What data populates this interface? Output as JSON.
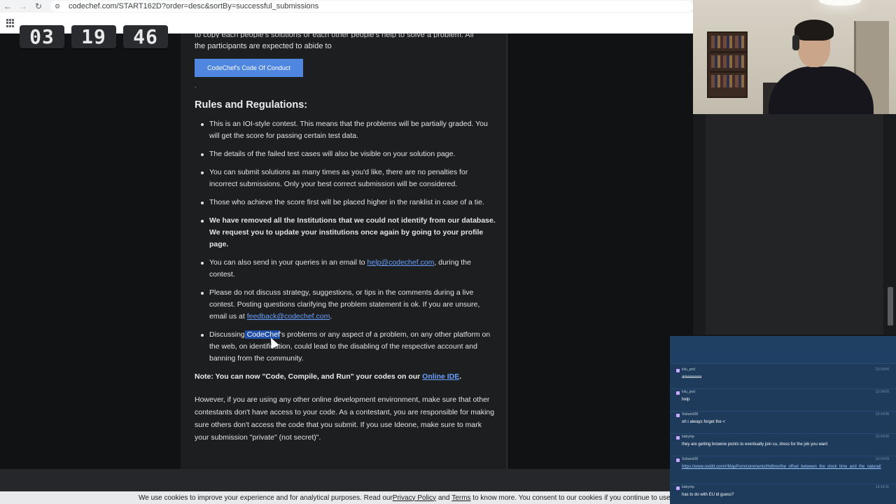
{
  "browser": {
    "url": "codechef.com/START162D?order=desc&sortBy=successful_submissions"
  },
  "timer": {
    "hours": "03",
    "minutes": "19",
    "seconds": "46"
  },
  "article": {
    "cut_text": "to copy each people's solutions or each other people's help to solve a problem. All",
    "intro_text": "the participants are expected to abide to",
    "coc_button": "CodeChef's Code Of Conduct",
    "dot": ".",
    "rules_title": "Rules and Regulations:",
    "rules": [
      {
        "text": "This is an IOI-style contest. This means that the problems will be partially graded. You will get the score for passing certain test data."
      },
      {
        "text": "The details of the failed test cases will also be visible on your solution page."
      },
      {
        "text": "You can submit solutions as many times as you'd like, there are no penalties for incorrect submissions. Only your best correct submission will be considered."
      },
      {
        "text": "Those who achieve the score first will be placed higher in the ranklist in case of a tie."
      },
      {
        "text": "We have removed all the Institutions that we could not identify from our database. We request you to update your institutions once again by going to your profile page."
      },
      {
        "before": "You can also send in your queries in an email to ",
        "link": "help@codechef.com",
        "after": ", during the contest."
      },
      {
        "before": "Please do not discuss strategy, suggestions, or tips in the comments during a live contest. Posting questions clarifying the problem statement is ok. If you are unsure, email us at ",
        "link": "feedback@codechef.com",
        "after": "."
      },
      {
        "before": "Discussing",
        "highlight": " CodeChef",
        "after": "'s problems or any aspect of a problem, on any other platform on the web, on identification, could lead to the disabling of the respective account and banning from the community."
      }
    ],
    "note_before": "Note: You can now \"Code, Compile, and Run\" your codes on our ",
    "note_link": "Online IDE",
    "note_after": ".",
    "paragraph": "However, if you are using any other online development environment, make sure that other contestants don't have access to your code. As a contestant, you are responsible for making sure others don't access the code that you submit. If you use Ideone, make sure to mark your submission \"private\" (not secret)\"."
  },
  "cookie_bar": {
    "before": "We use cookies to improve your experience and for analytical purposes. Read our ",
    "privacy": "Privacy Policy",
    "and": " and ",
    "terms": "Terms",
    "after": " to know more. You consent to our cookies if you continue to use our webs"
  },
  "chat": {
    "messages": [
      {
        "user": "lolu_pod",
        "time": "13:14:00",
        "text": "aiaaaaaaa"
      },
      {
        "user": "lolu_pod",
        "time": "13:14:00",
        "text": "help"
      },
      {
        "user": "Sobarot28",
        "time": "13:14:05",
        "text": "oh i always forget the <"
      },
      {
        "user": "babymp",
        "time": "13:14:05",
        "text": "they are getting brownie points to eventually join cu, dress for the job you want"
      },
      {
        "user": "Sobarot28",
        "time": "13:14:09",
        "text": "https://www.reddit.com/r/MapPorn/comments/thdbnv/the_offset_between_the_clock_time_and_the_natural/",
        "is_link": true
      },
      {
        "user": "babymp",
        "time": "13:14:11",
        "text": "has to do with EU id guess?"
      }
    ]
  },
  "colors": {
    "page_bg": "#111214",
    "article_bg": "#1d1e20",
    "accent_button": "#4f86e0",
    "link": "#6aa1ff",
    "chat_bg": "#1e3b5c"
  }
}
